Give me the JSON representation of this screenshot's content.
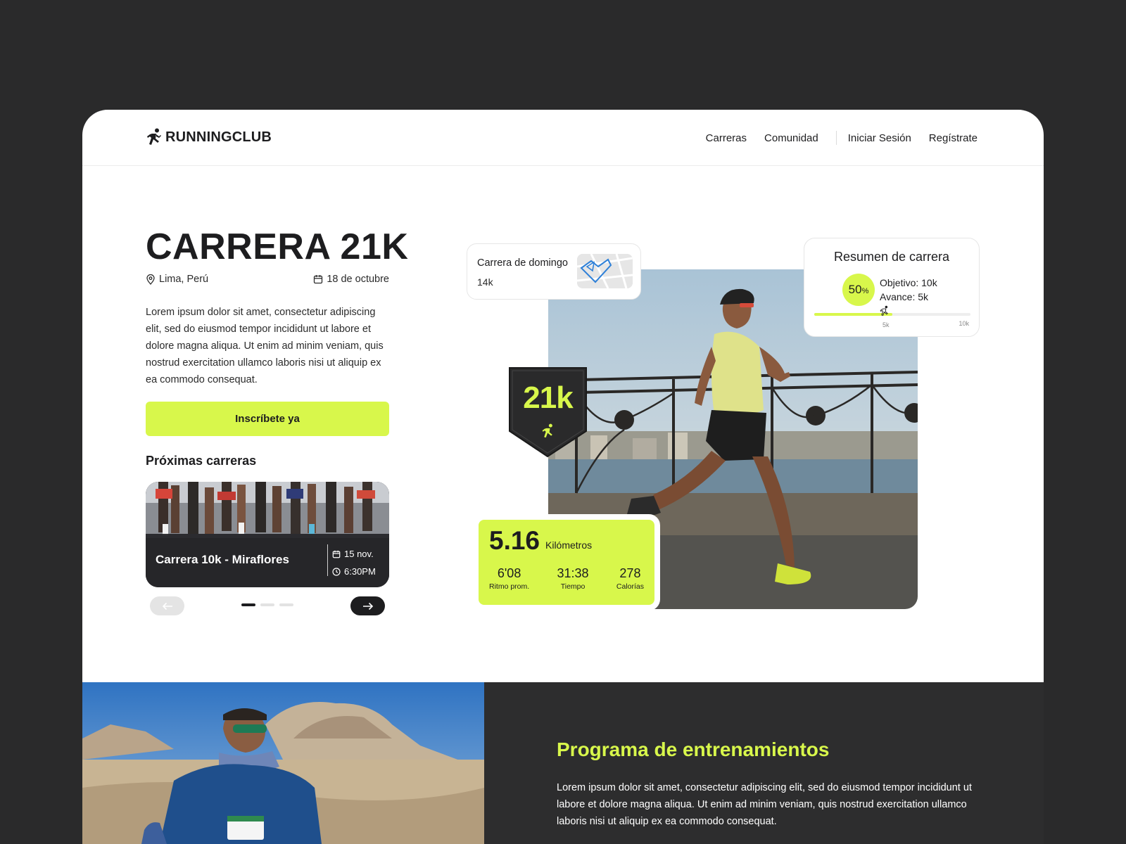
{
  "brand": {
    "name": "RUNNINGCLUB",
    "accent": "#d8f74b",
    "dark": "#2a2a2b"
  },
  "nav": {
    "links": [
      "Carreras",
      "Comunidad"
    ],
    "login": "Iniciar Sesión",
    "register": "Regístrate"
  },
  "hero": {
    "title": "CARRERA 21K",
    "location": "Lima, Perú",
    "date": "18 de octubre",
    "description": "Lorem ipsum dolor sit amet, consectetur adipiscing elit, sed do eiusmod tempor incididunt ut labore et dolore magna aliqua. Ut enim ad minim veniam, quis nostrud exercitation ullamco laboris nisi ut aliquip ex ea commodo consequat.",
    "cta": "Inscríbete ya"
  },
  "upcoming": {
    "title": "Próximas carreras",
    "card": {
      "name": "Carrera 10k - Miraflores",
      "date": "15 nov.",
      "time": "6:30PM"
    },
    "carousel": {
      "pages": 3,
      "active": 1
    }
  },
  "sunday_card": {
    "title": "Carrera de domingo",
    "distance": "14k"
  },
  "summary": {
    "title": "Resumen de carrera",
    "percent": "50",
    "percent_symbol": "%",
    "goal": "Objetivo: 10k",
    "progress": "Avance: 5k",
    "progress_fraction": 0.5,
    "tick_mid": "5k",
    "tick_end": "10k"
  },
  "badge": {
    "label": "21k"
  },
  "stats": {
    "distance": "5.16",
    "distance_unit": "Kilómetros",
    "items": [
      {
        "value": "6'08",
        "label": "Ritmo prom."
      },
      {
        "value": "31:38",
        "label": "Tiempo"
      },
      {
        "value": "278",
        "label": "Calorías"
      }
    ]
  },
  "training": {
    "title": "Programa de entrenamientos",
    "description": "Lorem ipsum dolor sit amet, consectetur adipiscing elit, sed do eiusmod tempor incididunt ut labore et dolore magna aliqua. Ut enim ad minim veniam, quis nostrud exercitation ullamco laboris nisi ut aliquip ex ea commodo consequat."
  },
  "icons": [
    "runner-logo-icon",
    "location-pin-icon",
    "calendar-icon",
    "clock-icon",
    "arrow-left-icon",
    "arrow-right-icon",
    "runner-icon",
    "map-route-icon"
  ]
}
